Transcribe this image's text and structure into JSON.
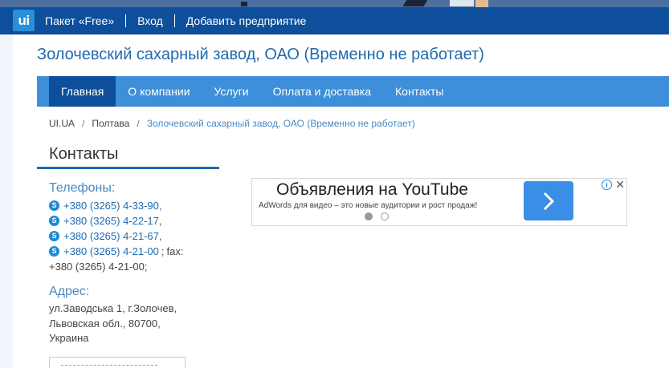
{
  "topbar": {
    "logo": "ui",
    "links": [
      "Пакет «Free»",
      "Вход",
      "Добавить предприятие"
    ]
  },
  "site_title": "Золочевский сахарный завод, ОАО (Временно не работает)",
  "mainnav": [
    "Главная",
    "О компании",
    "Услуги",
    "Оплата и доставка",
    "Контакты"
  ],
  "breadcrumb": [
    "UI.UA",
    "Полтава",
    "Золочевский сахарный завод, ОАО (Временно не работает)"
  ],
  "breadcrumb_sep": "/",
  "contacts": {
    "heading": "Контакты",
    "phones_label": "Телефоны:",
    "phones": [
      "+380 (3265) 4-33-90",
      "+380 (3265) 4-22-17",
      "+380 (3265) 4-21-67",
      "+380 (3265) 4-21-00"
    ],
    "fax_label": "fax:",
    "fax": "+380 (3265) 4-21-00;",
    "address_label": "Адрес:",
    "address_lines": [
      "ул.Заводська 1, г.Золочев,",
      "Львовская обл., 80700,",
      "Украина"
    ]
  },
  "ad": {
    "title": "Объявления на YouTube",
    "subtitle": "AdWords для видео – это новые аудитории и рост продаж!",
    "info_icon": "i",
    "close_icon": "✕"
  },
  "colors": {
    "topbar": "#0d4f9b",
    "nav": "#3d8fd9",
    "nav_active": "#0d4f9b",
    "title": "#1e6ab0",
    "link": "#1e6ab0"
  }
}
